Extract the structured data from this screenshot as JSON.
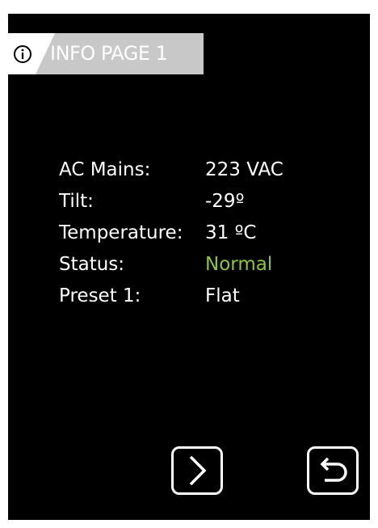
{
  "header": {
    "title": "INFO PAGE 1",
    "icon": "info-icon",
    "tab_color": "#c8c8c8"
  },
  "info": {
    "rows": [
      {
        "label": "AC Mains:",
        "value": "223 VAC"
      },
      {
        "label": "Tilt:",
        "value": "-29º"
      },
      {
        "label": "Temperature:",
        "value": "31 ºC"
      },
      {
        "label": "Status:",
        "value": "Normal",
        "value_color": "#8cc63f"
      },
      {
        "label": "Preset 1:",
        "value": "Flat"
      }
    ]
  },
  "controls": {
    "next_icon": "chevron-right-icon",
    "back_icon": "return-arrow-icon"
  },
  "colors": {
    "background": "#000000",
    "text": "#ffffff",
    "status_ok": "#8cc63f"
  }
}
